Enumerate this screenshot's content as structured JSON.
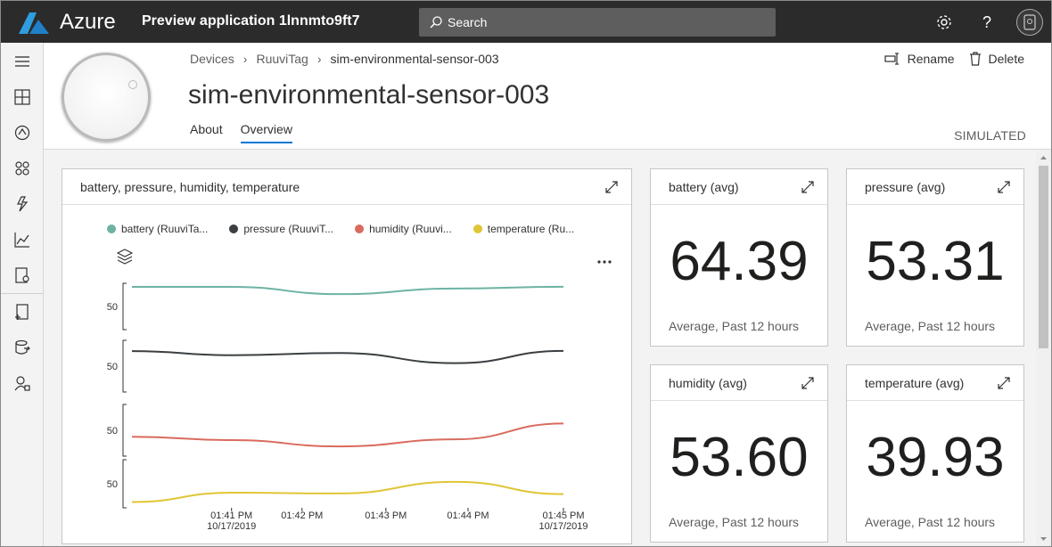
{
  "topbar": {
    "brand": "Azure",
    "app_title": "Preview application 1lnnmto9ft7",
    "search_placeholder": "Search"
  },
  "breadcrumb": [
    "Devices",
    "RuuviTag",
    "sim-environmental-sensor-003"
  ],
  "device": {
    "title": "sim-environmental-sensor-003",
    "status": "SIMULATED"
  },
  "tabs": [
    {
      "label": "About",
      "active": false
    },
    {
      "label": "Overview",
      "active": true
    }
  ],
  "actions": {
    "rename": "Rename",
    "delete": "Delete"
  },
  "chart_tile": {
    "title": "battery, pressure, humidity, temperature"
  },
  "chart_data": {
    "type": "line",
    "x": [
      "01:41 PM",
      "01:42 PM",
      "01:43 PM",
      "01:44 PM",
      "01:45 PM"
    ],
    "x_dates": [
      "10/17/2019",
      "",
      "",
      "",
      "10/17/2019"
    ],
    "series": [
      {
        "name": "battery (RuuviTa...",
        "color": "#6db3a3",
        "tick_label": "50",
        "values": [
          [
            0.0,
            71.2
          ],
          [
            1.2,
            71.2
          ],
          [
            2.5,
            63.3
          ],
          [
            3.9,
            69.3
          ],
          [
            5.2,
            71.3
          ]
        ]
      },
      {
        "name": "pressure (RuuviT...",
        "color": "#3b3f42",
        "tick_label": "50",
        "values": [
          [
            0.0,
            64.6
          ],
          [
            1.2,
            60.6
          ],
          [
            2.5,
            62.7
          ],
          [
            3.9,
            52.9
          ],
          [
            5.2,
            64.8
          ]
        ]
      },
      {
        "name": "humidity (Ruuvi...",
        "color": "#d96b5f",
        "tick_label": "50",
        "values": [
          [
            0.0,
            43.7
          ],
          [
            1.2,
            40.5
          ],
          [
            2.5,
            34.4
          ],
          [
            3.9,
            41.3
          ],
          [
            5.2,
            56.6
          ]
        ]
      },
      {
        "name": "temperature (Ru...",
        "color": "#e0c536",
        "tick_label": "50",
        "values": [
          [
            0.0,
            31.0
          ],
          [
            1.2,
            40.7
          ],
          [
            2.5,
            39.9
          ],
          [
            3.9,
            52.0
          ],
          [
            5.2,
            39.2
          ]
        ]
      }
    ]
  },
  "kpis": [
    {
      "title": "battery (avg)",
      "value": "64.39",
      "subtitle": "Average, Past 12 hours"
    },
    {
      "title": "pressure (avg)",
      "value": "53.31",
      "subtitle": "Average, Past 12 hours"
    },
    {
      "title": "humidity (avg)",
      "value": "53.60",
      "subtitle": "Average, Past 12 hours"
    },
    {
      "title": "temperature (avg)",
      "value": "39.93",
      "subtitle": "Average, Past 12 hours"
    }
  ],
  "rail_icons": [
    "hamburger-icon",
    "dashboard-icon",
    "devices-icon",
    "device-groups-icon",
    "rules-icon",
    "analytics-icon",
    "jobs-icon",
    "device-templates-icon",
    "data-export-icon",
    "administration-icon"
  ]
}
